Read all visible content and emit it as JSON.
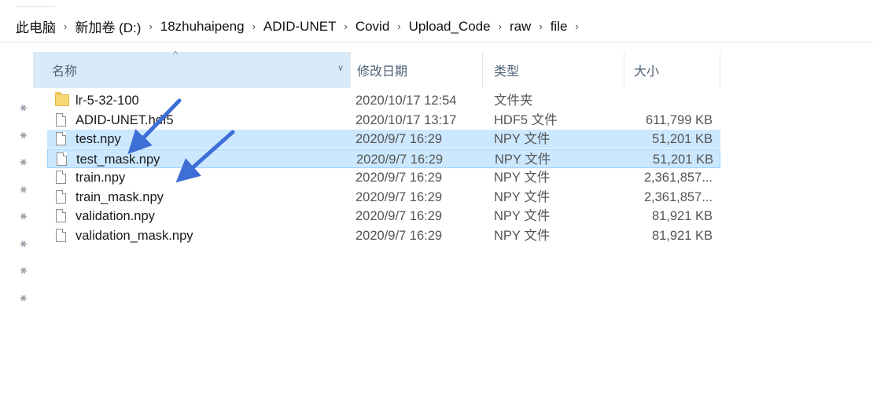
{
  "breadcrumb": [
    {
      "label": "此电脑"
    },
    {
      "label": "新加卷 (D:)"
    },
    {
      "label": "18zhuhaipeng"
    },
    {
      "label": "ADID-UNET"
    },
    {
      "label": "Covid"
    },
    {
      "label": "Upload_Code"
    },
    {
      "label": "raw"
    },
    {
      "label": "file"
    }
  ],
  "separator": "›",
  "columns": {
    "name": "名称",
    "date": "修改日期",
    "type": "类型",
    "size": "大小"
  },
  "files": [
    {
      "name": "lr-5-32-100",
      "date": "2020/10/17 12:54",
      "type": "文件夹",
      "size": "",
      "kind": "folder"
    },
    {
      "name": "ADID-UNET.hdf5",
      "date": "2020/10/17 13:17",
      "type": "HDF5 文件",
      "size": "611,799 KB",
      "kind": "file"
    },
    {
      "name": "test.npy",
      "date": "2020/9/7 16:29",
      "type": "NPY 文件",
      "size": "51,201 KB",
      "kind": "file",
      "selected": true
    },
    {
      "name": "test_mask.npy",
      "date": "2020/9/7 16:29",
      "type": "NPY 文件",
      "size": "51,201 KB",
      "kind": "file",
      "selected": true,
      "focused": true
    },
    {
      "name": "train.npy",
      "date": "2020/9/7 16:29",
      "type": "NPY 文件",
      "size": "2,361,857...",
      "kind": "file"
    },
    {
      "name": "train_mask.npy",
      "date": "2020/9/7 16:29",
      "type": "NPY 文件",
      "size": "2,361,857...",
      "kind": "file"
    },
    {
      "name": "validation.npy",
      "date": "2020/9/7 16:29",
      "type": "NPY 文件",
      "size": "81,921 KB",
      "kind": "file"
    },
    {
      "name": "validation_mask.npy",
      "date": "2020/9/7 16:29",
      "type": "NPY 文件",
      "size": "81,921 KB",
      "kind": "file"
    }
  ],
  "pin_count": 8,
  "colors": {
    "selection": "#cce8ff",
    "header_active": "#d9ebf9",
    "arrow": "#3d6fd6"
  }
}
